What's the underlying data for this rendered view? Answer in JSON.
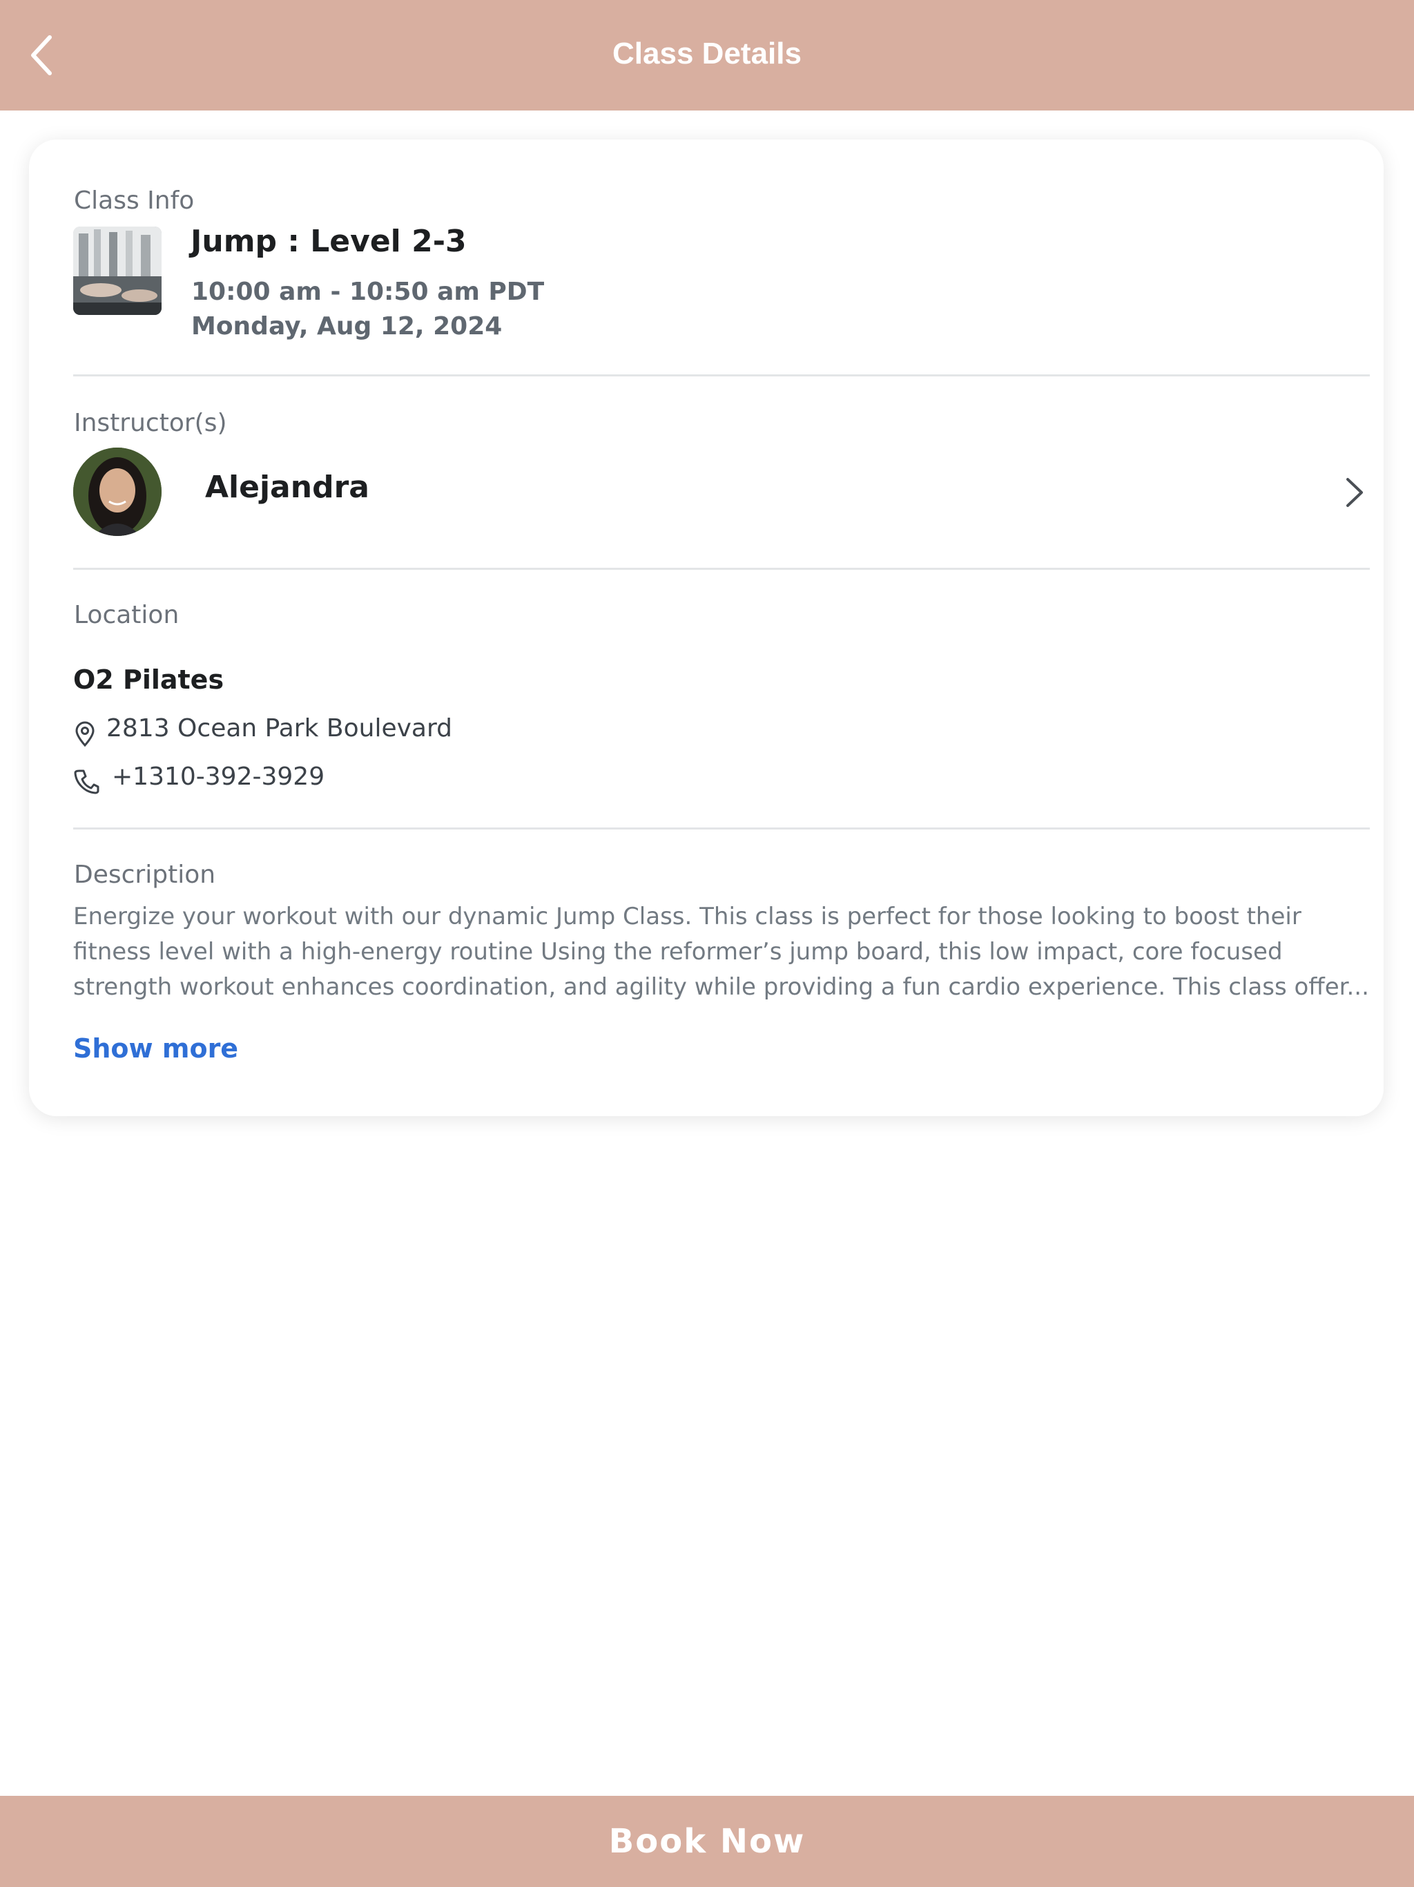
{
  "header": {
    "title": "Class Details",
    "back_icon": "chevron-left-icon"
  },
  "class_info": {
    "label": "Class Info",
    "title": "Jump : Level 2-3",
    "time": "10:00 am - 10:50 am PDT",
    "date": "Monday, Aug 12, 2024"
  },
  "instructors": {
    "label": "Instructor(s)",
    "name": "Alejandra",
    "chevron_icon": "chevron-right-icon"
  },
  "location": {
    "label": "Location",
    "name": "O2 Pilates",
    "address": "2813 Ocean Park Boulevard",
    "phone": "+1310-392-3929"
  },
  "description": {
    "label": "Description",
    "text": "Energize your workout with our dynamic Jump Class. This class is perfect for those looking to boost their fitness level with a high-energy routine Using the reformer’s jump board, this low impact, core focused strength workout enhances coordination, and agility while providing a fun cardio experience. This class offer...",
    "show_more": "Show more"
  },
  "footer": {
    "book_label": "Book Now"
  },
  "colors": {
    "accent": "#d8afa0",
    "link": "#2f6fd6"
  }
}
